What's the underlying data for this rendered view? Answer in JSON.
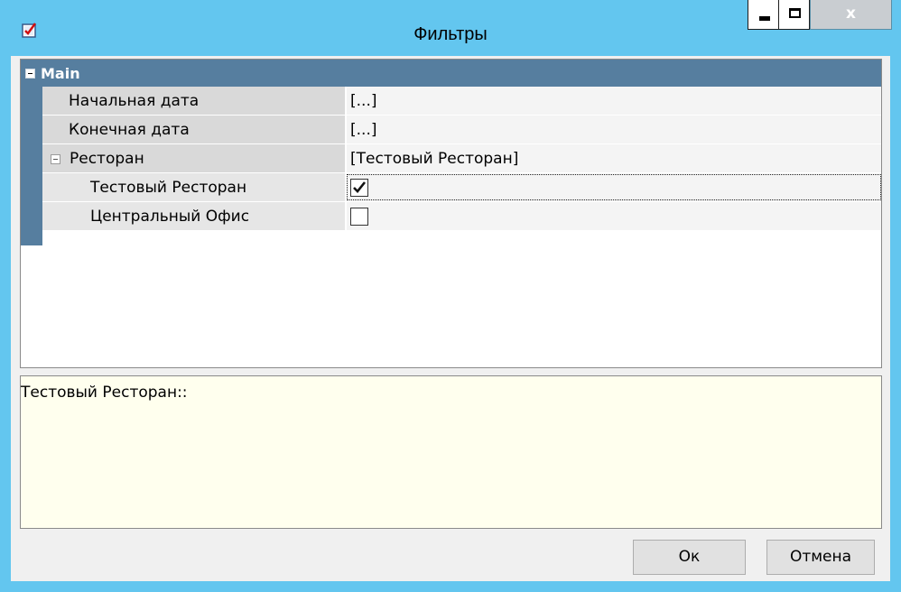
{
  "window": {
    "title": "Фильтры",
    "app_icon": "checklist-icon",
    "controls": {
      "minimize_icon": "minimize-icon",
      "maximize_icon": "maximize-icon",
      "close_label": "x"
    }
  },
  "property_grid": {
    "category": {
      "label": "Main",
      "expanded": true
    },
    "rows": [
      {
        "name": "Начальная дата",
        "value": "[...]"
      },
      {
        "name": "Конечная дата",
        "value": "[...]"
      },
      {
        "name": "Ресторан",
        "value": "[Тестовый Ресторан]",
        "expanded": true,
        "children": [
          {
            "name": "Тестовый Ресторан",
            "checked": true
          },
          {
            "name": "Центральный Офис",
            "checked": false
          }
        ]
      }
    ]
  },
  "description": {
    "text": "Тестовый Ресторан::"
  },
  "buttons": {
    "ok": "Ок",
    "cancel": "Отмена"
  },
  "colors": {
    "window_border": "#63c6ef",
    "category_band": "#567e9f",
    "description_bg": "#ffffee"
  }
}
